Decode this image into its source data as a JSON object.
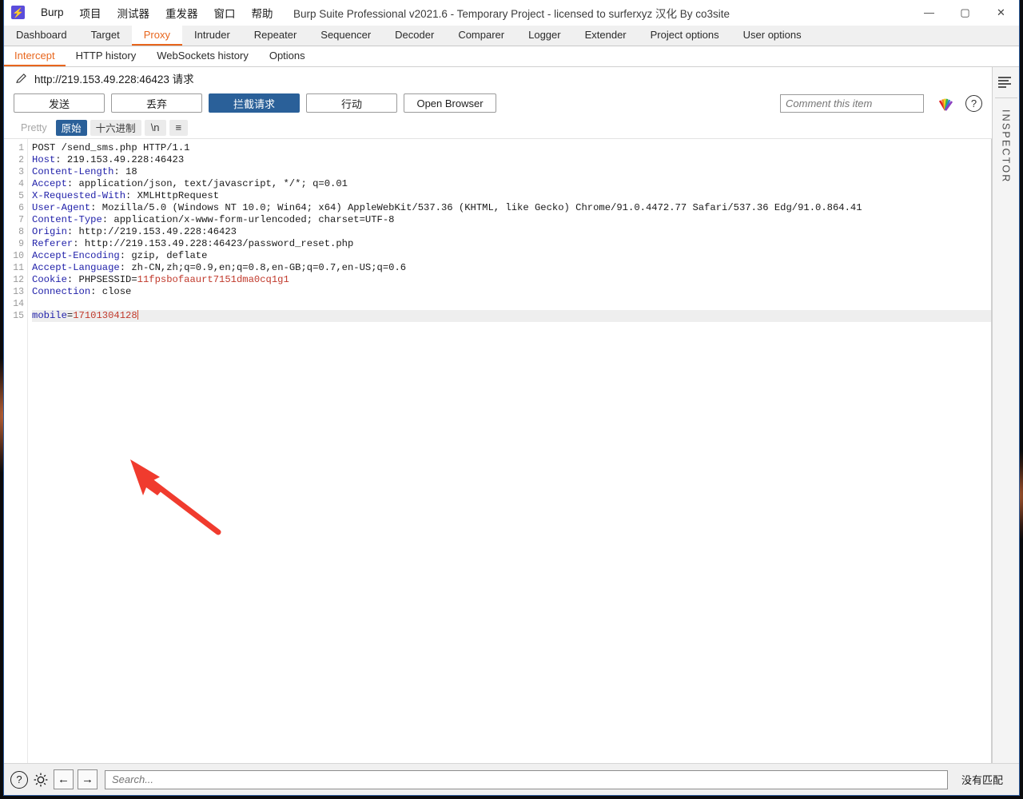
{
  "window": {
    "title": "Burp Suite Professional v2021.6 - Temporary Project - licensed to surferxyz 汉化 By co3site",
    "logo_icon": "burp-lightning-icon",
    "minimize_label": "—",
    "maximize_label": "▢",
    "close_label": "✕"
  },
  "menubar": {
    "items": [
      {
        "label": "Burp"
      },
      {
        "label": "项目"
      },
      {
        "label": "测试器"
      },
      {
        "label": "重发器"
      },
      {
        "label": "窗口"
      },
      {
        "label": "帮助"
      }
    ]
  },
  "main_tabs": {
    "active": "Proxy",
    "items": [
      {
        "label": "Dashboard"
      },
      {
        "label": "Target"
      },
      {
        "label": "Proxy"
      },
      {
        "label": "Intruder"
      },
      {
        "label": "Repeater"
      },
      {
        "label": "Sequencer"
      },
      {
        "label": "Decoder"
      },
      {
        "label": "Comparer"
      },
      {
        "label": "Logger"
      },
      {
        "label": "Extender"
      },
      {
        "label": "Project options"
      },
      {
        "label": "User options"
      }
    ]
  },
  "sub_tabs": {
    "active": "Intercept",
    "items": [
      {
        "label": "Intercept"
      },
      {
        "label": "HTTP history"
      },
      {
        "label": "WebSockets history"
      },
      {
        "label": "Options"
      }
    ]
  },
  "request_header": {
    "edit_icon": "pencil-icon",
    "text": "http://219.153.49.228:46423 请求"
  },
  "action_bar": {
    "forward_label": "发送",
    "drop_label": "丢弃",
    "intercept_label": "拦截请求",
    "action_label": "行动",
    "open_browser_label": "Open Browser",
    "comment_placeholder": "Comment this item",
    "comment_value": "",
    "highlighter_icon": "rainbow-highlighter-icon",
    "help_icon": "help-circle-icon",
    "help_label": "?"
  },
  "view_modes": {
    "active": "原始",
    "items": [
      {
        "label": "Pretty",
        "state": "disabled"
      },
      {
        "label": "原始",
        "state": "active"
      },
      {
        "label": "十六进制",
        "state": "normal"
      },
      {
        "label": "\\n",
        "state": "normal"
      },
      {
        "label": "≡",
        "state": "normal"
      }
    ]
  },
  "editor": {
    "line_numbers": [
      "1",
      "2",
      "3",
      "4",
      "5",
      "6",
      "7",
      "8",
      "9",
      "10",
      "11",
      "12",
      "13",
      "14",
      "15"
    ],
    "highlighted_line": 15,
    "caret_line": 15,
    "lines": [
      {
        "n": 1,
        "segments": [
          {
            "t": "POST /send_sms.php HTTP/1.1",
            "c": "plain"
          }
        ]
      },
      {
        "n": 2,
        "segments": [
          {
            "t": "Host",
            "c": "header"
          },
          {
            "t": ": 219.153.49.228:46423",
            "c": "plain"
          }
        ]
      },
      {
        "n": 3,
        "segments": [
          {
            "t": "Content-Length",
            "c": "header"
          },
          {
            "t": ": 18",
            "c": "plain"
          }
        ]
      },
      {
        "n": 4,
        "segments": [
          {
            "t": "Accept",
            "c": "header"
          },
          {
            "t": ": application/json, text/javascript, */*; q=0.01",
            "c": "plain"
          }
        ]
      },
      {
        "n": 5,
        "segments": [
          {
            "t": "X-Requested-With",
            "c": "header"
          },
          {
            "t": ": XMLHttpRequest",
            "c": "plain"
          }
        ]
      },
      {
        "n": 6,
        "segments": [
          {
            "t": "User-Agent",
            "c": "header"
          },
          {
            "t": ": Mozilla/5.0 (Windows NT 10.0; Win64; x64) AppleWebKit/537.36 (KHTML, like Gecko) Chrome/91.0.4472.77 Safari/537.36 Edg/91.0.864.41",
            "c": "plain"
          }
        ]
      },
      {
        "n": 7,
        "segments": [
          {
            "t": "Content-Type",
            "c": "header"
          },
          {
            "t": ": application/x-www-form-urlencoded; charset=UTF-8",
            "c": "plain"
          }
        ]
      },
      {
        "n": 8,
        "segments": [
          {
            "t": "Origin",
            "c": "header"
          },
          {
            "t": ": http://219.153.49.228:46423",
            "c": "plain"
          }
        ]
      },
      {
        "n": 9,
        "segments": [
          {
            "t": "Referer",
            "c": "header"
          },
          {
            "t": ": http://219.153.49.228:46423/password_reset.php",
            "c": "plain"
          }
        ]
      },
      {
        "n": 10,
        "segments": [
          {
            "t": "Accept-Encoding",
            "c": "header"
          },
          {
            "t": ": gzip, deflate",
            "c": "plain"
          }
        ]
      },
      {
        "n": 11,
        "segments": [
          {
            "t": "Accept-Language",
            "c": "header"
          },
          {
            "t": ": zh-CN,zh;q=0.9,en;q=0.8,en-GB;q=0.7,en-US;q=0.6",
            "c": "plain"
          }
        ]
      },
      {
        "n": 12,
        "segments": [
          {
            "t": "Cookie",
            "c": "header"
          },
          {
            "t": ": PHPSESSID=",
            "c": "plain"
          },
          {
            "t": "11fpsbofaaurt7151dma0cq1g1",
            "c": "value"
          }
        ]
      },
      {
        "n": 13,
        "segments": [
          {
            "t": "Connection",
            "c": "header"
          },
          {
            "t": ": close",
            "c": "plain"
          }
        ]
      },
      {
        "n": 14,
        "segments": [
          {
            "t": "",
            "c": "plain"
          }
        ]
      },
      {
        "n": 15,
        "segments": [
          {
            "t": "mobile",
            "c": "header"
          },
          {
            "t": "=",
            "c": "plain"
          },
          {
            "t": "17101304128",
            "c": "value"
          }
        ]
      }
    ]
  },
  "annotation": {
    "arrow_color": "#f03b2e",
    "arrow_points_to": "mobile-parameter-value"
  },
  "inspector": {
    "toggle_icon": "inspector-lines-icon",
    "label": "INSPECTOR"
  },
  "bottom_bar": {
    "help_icon": "help-circle-icon",
    "help_label": "?",
    "settings_icon": "gear-icon",
    "back_icon": "arrow-left-icon",
    "back_label": "←",
    "forward_icon": "arrow-right-icon",
    "forward_label": "→",
    "search_placeholder": "Search...",
    "search_value": "",
    "match_status": "没有匹配"
  },
  "colors": {
    "accent": "#e8661d",
    "primary_button": "#2a6099",
    "header_token": "#2222aa",
    "value_token": "#c0392b",
    "annotation_red": "#f03b2e"
  }
}
